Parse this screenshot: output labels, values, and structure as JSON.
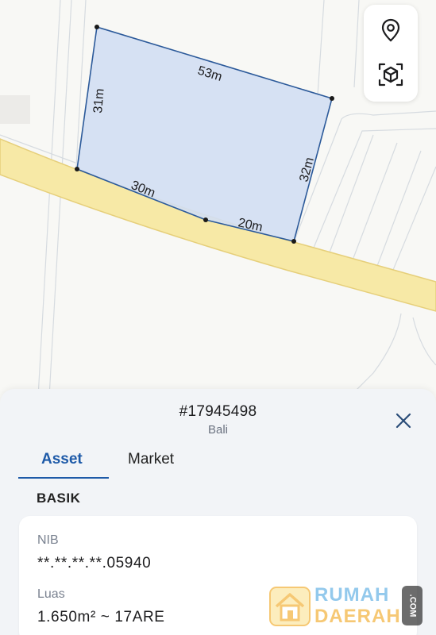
{
  "map": {
    "edge_labels": {
      "top": "53m",
      "left": "31m",
      "right": "32m",
      "bottom_left": "30m",
      "bottom_right": "20m"
    },
    "colors": {
      "parcel_fill": "#d2def2",
      "parcel_stroke": "#2c5a9a",
      "road_fill": "#f7e9a6",
      "road_stroke": "#e6cf7a",
      "map_background": "#f8f8f5"
    },
    "controls": {
      "location_icon": "location-pin-icon",
      "view_3d_icon": "cube-scan-icon"
    }
  },
  "sheet": {
    "parcel_id": "#17945498",
    "region": "Bali",
    "close_icon": "close-icon",
    "tabs": [
      {
        "label": "Asset",
        "active": true
      },
      {
        "label": "Market",
        "active": false
      }
    ],
    "section_title": "BASIK",
    "fields": {
      "nib_label": "NIB",
      "nib_value": "**.**.**.**.05940",
      "luas_label": "Luas",
      "luas_value": "1.650m² ~ 17ARE"
    },
    "accent_color": "#1e5aa8"
  },
  "watermark": {
    "line1": "RUMAH",
    "line2": "DAERAH",
    "suffix": ".COM"
  }
}
